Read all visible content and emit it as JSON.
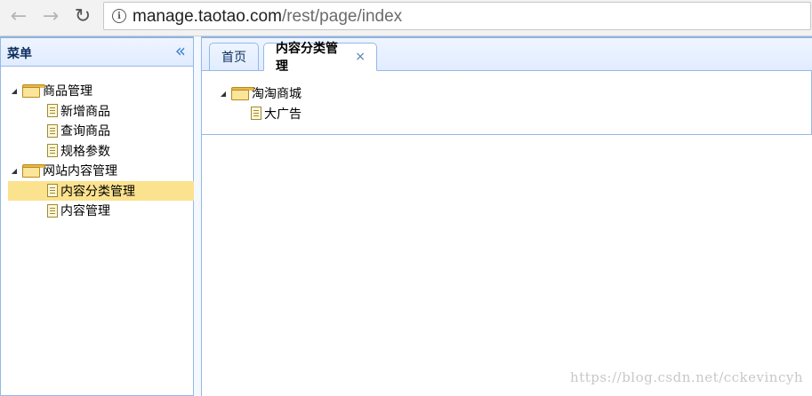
{
  "browser": {
    "url_host": "manage.taotao.com",
    "url_path": "/rest/page/index",
    "icons": {
      "back": "arrow-left-icon",
      "forward": "arrow-right-icon",
      "reload": "reload-icon",
      "info": "info-icon"
    }
  },
  "menu": {
    "title": "菜单",
    "collapse_icon": "double-chevron-left-icon",
    "items": [
      {
        "label": "商品管理",
        "type": "folder",
        "expanded": true
      },
      {
        "label": "新增商品",
        "type": "file"
      },
      {
        "label": "查询商品",
        "type": "file"
      },
      {
        "label": "规格参数",
        "type": "file"
      },
      {
        "label": "网站内容管理",
        "type": "folder",
        "expanded": true
      },
      {
        "label": "内容分类管理",
        "type": "file",
        "selected": true
      },
      {
        "label": "内容管理",
        "type": "file"
      }
    ]
  },
  "tabs": [
    {
      "label": "首页",
      "active": false
    },
    {
      "label": "内容分类管理",
      "active": true,
      "closable": true
    }
  ],
  "content_tree": [
    {
      "label": "淘淘商城",
      "type": "folder",
      "expanded": true
    },
    {
      "label": "大广告",
      "type": "file"
    }
  ],
  "colors": {
    "selected": "#fbe28e",
    "panel_border": "#95b8e7",
    "header_bg": "#e0ecff"
  },
  "watermark": "https://blog.csdn.net/cckevincyh"
}
